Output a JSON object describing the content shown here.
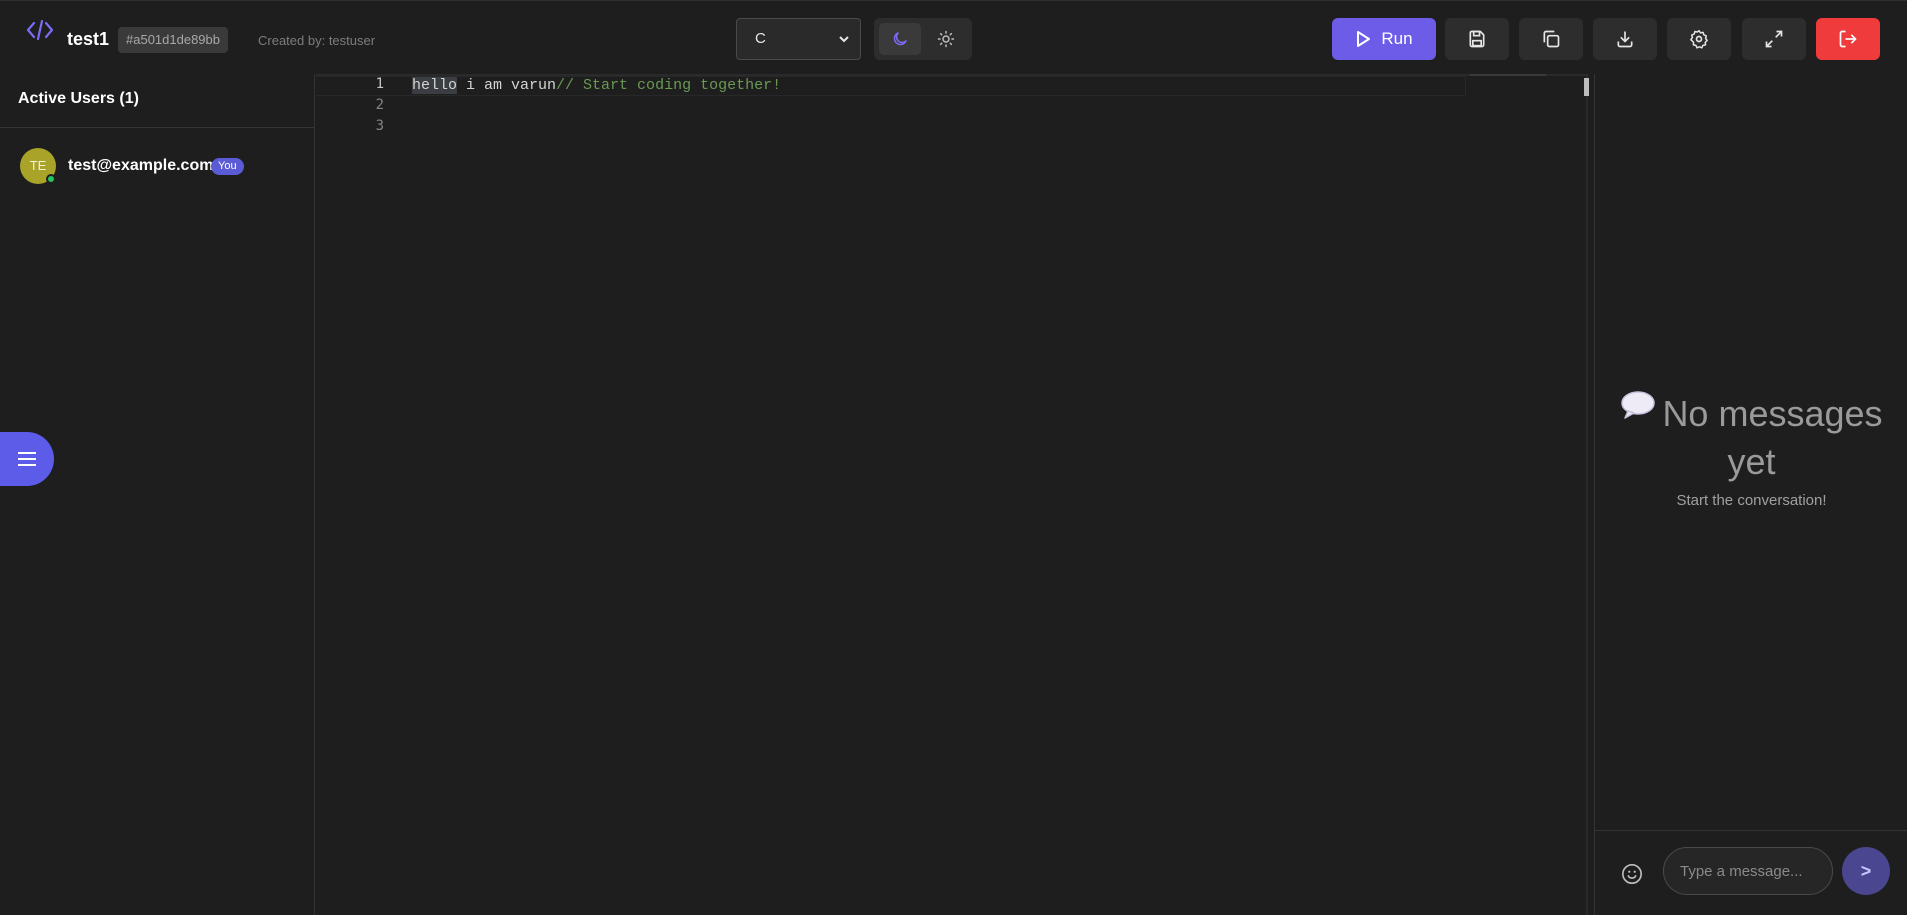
{
  "header": {
    "room_name": "test1",
    "room_id": "#a501d1de89bb",
    "created_by": "Created by: testuser",
    "language": "C",
    "run_label": "Run"
  },
  "sidebar": {
    "title": "Active Users (1)",
    "users": [
      {
        "initials": "TE",
        "email": "test@example.com",
        "badge": "You"
      }
    ]
  },
  "editor": {
    "line_numbers": [
      "1",
      "2",
      "3"
    ],
    "line1": {
      "highlight": "hello",
      "text": " i am varun",
      "comment": "// Start coding together!"
    }
  },
  "chat": {
    "empty_title": "No messages yet",
    "empty_subtitle": "Start the conversation!",
    "input_placeholder": "Type a message...",
    "send_label": ">"
  },
  "colors": {
    "accent": "#6c5ce7",
    "exit": "#ef3b3b",
    "online": "#22c55e",
    "avatar": "#a9a32a"
  },
  "icons": [
    "code-icon",
    "moon-icon",
    "sun-icon",
    "play-icon",
    "save-icon",
    "copy-icon",
    "download-icon",
    "gear-icon",
    "expand-icon",
    "logout-icon",
    "menu-icon",
    "chat-bubble-icon",
    "smile-icon",
    "chevron-down-icon"
  ]
}
